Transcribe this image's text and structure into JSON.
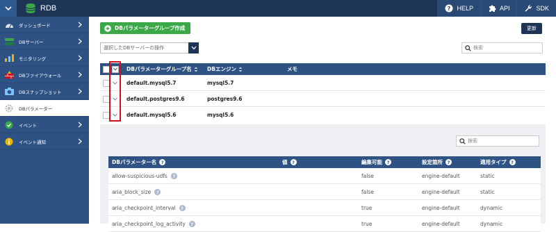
{
  "header": {
    "title": "RDB",
    "actions": [
      {
        "label": "HELP",
        "icon": "help-icon"
      },
      {
        "label": "API",
        "icon": "puzzle-icon"
      },
      {
        "label": "SDK",
        "icon": "wrench-icon"
      }
    ]
  },
  "sidebar": {
    "items": [
      {
        "label": "ダッシュボード",
        "icon": "dashboard-icon"
      },
      {
        "label": "DBサーバー",
        "icon": "server-icon"
      },
      {
        "label": "モニタリング",
        "icon": "chart-icon"
      },
      {
        "label": "DBファイアウォール",
        "icon": "firewall-icon"
      },
      {
        "label": "DBスナップショット",
        "icon": "camera-icon"
      },
      {
        "label": "DBパラメーター",
        "icon": "gear-icon",
        "active": true
      },
      {
        "label": "イベント",
        "icon": "event-icon"
      },
      {
        "label": "イベント通知",
        "icon": "info-icon"
      }
    ]
  },
  "toolbar": {
    "create_label": "DBパラメーターグループ作成",
    "refresh_label": "更新",
    "action_select": "選択したDBサーバーの操作",
    "search_placeholder": "検索"
  },
  "groups_table": {
    "columns": [
      "DBパラメーターグループ名",
      "DBエンジン",
      "メモ"
    ],
    "rows": [
      {
        "name": "default.mysql5.7",
        "engine": "mysql5.7",
        "memo": ""
      },
      {
        "name": "default.postgres9.6",
        "engine": "postgres9.6",
        "memo": ""
      },
      {
        "name": "default.mysql5.6",
        "engine": "mysql5.6",
        "memo": ""
      }
    ]
  },
  "detail": {
    "search_placeholder": "検索",
    "columns": [
      "DBパラメーター名",
      "値",
      "編集可能",
      "設定箇所",
      "適用タイプ"
    ],
    "rows": [
      {
        "name": "allow-suspicious-udfs",
        "value": "",
        "editable": "false",
        "source": "engine-default",
        "apply_type": "static"
      },
      {
        "name": "aria_block_size",
        "value": "",
        "editable": "false",
        "source": "engine-default",
        "apply_type": "static"
      },
      {
        "name": "aria_checkpoint_interval",
        "value": "",
        "editable": "true",
        "source": "engine-default",
        "apply_type": "dynamic"
      },
      {
        "name": "aria_checkpoint_log_activity",
        "value": "",
        "editable": "true",
        "source": "engine-default",
        "apply_type": "dynamic"
      }
    ]
  },
  "colors": {
    "topbar": "#1e3557",
    "sidebar": "#2e5283",
    "table_header": "#2e5283",
    "create_button": "#3aa847",
    "highlight": "#d0101a"
  }
}
